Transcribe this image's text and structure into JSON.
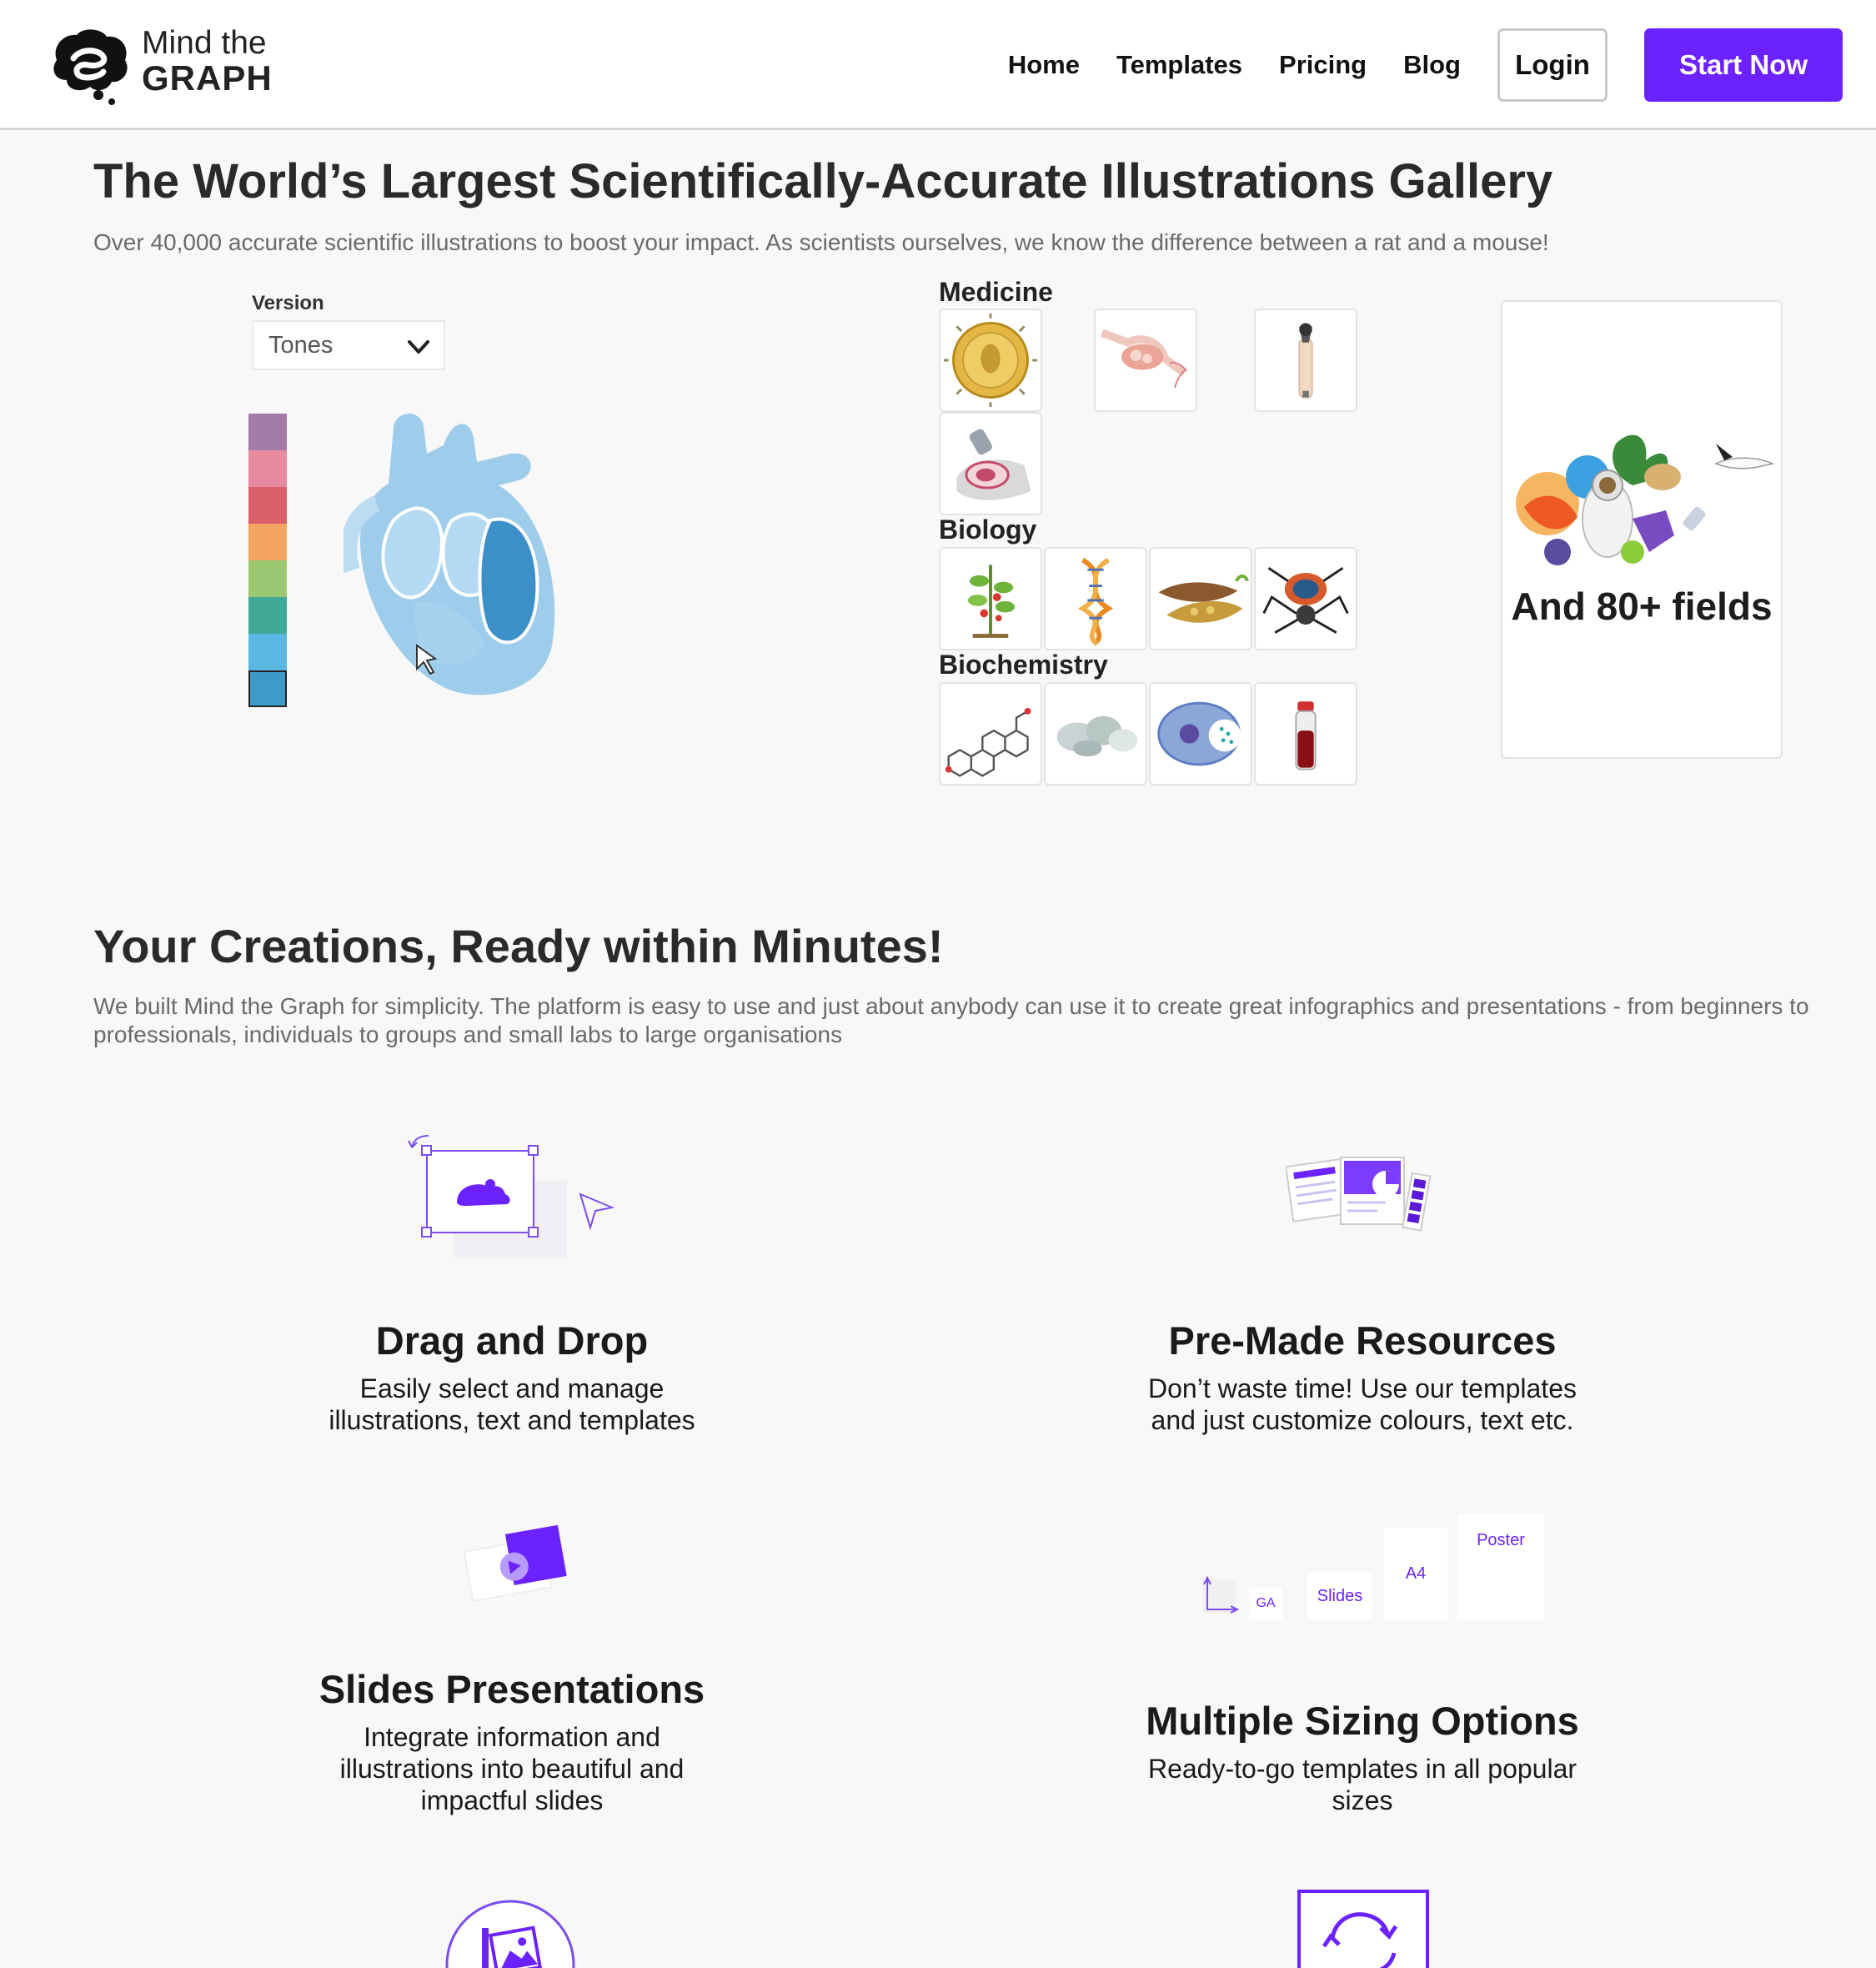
{
  "header": {
    "logo_line1": "Mind the",
    "logo_line2": "GRAPH",
    "nav": [
      "Home",
      "Templates",
      "Pricing",
      "Blog"
    ],
    "login_label": "Login",
    "start_label": "Start Now",
    "accent_color": "#6c21ff"
  },
  "gallery": {
    "title": "The World’s Largest Scientifically-Accurate Illustrations Gallery",
    "subtitle": "Over 40,000 accurate scientific illustrations to boost your impact. As scientists ourselves, we know the difference between a rat and a mouse!",
    "version_label": "Version",
    "version_value": "Tones",
    "tone_swatches": [
      "#a47aa8",
      "#e88aa0",
      "#d95f6a",
      "#f2a661",
      "#9cc772",
      "#3fa996",
      "#5bb8e2",
      "#3c9bc9"
    ],
    "categories": {
      "medicine": "Medicine",
      "biology": "Biology",
      "biochemistry": "Biochemistry"
    },
    "fields_text": "And 80+ fields"
  },
  "creations": {
    "title": "Your Creations, Ready within Minutes!",
    "subtitle": "We built Mind the Graph for simplicity. The platform is easy to use and just about anybody can use it to create great infographics and presentations - from beginners to professionals, individuals to groups and small labs to large organisations",
    "features": [
      {
        "title": "Drag and Drop",
        "desc": "Easily select and manage illustrations, text and templates"
      },
      {
        "title": "Pre-Made Resources",
        "desc": "Don’t waste time! Use our templates and just customize colours, text etc."
      },
      {
        "title": "Slides Presentations",
        "desc": "Integrate information and illustrations into beautiful and impactful slides"
      },
      {
        "title": "Multiple Sizing Options",
        "desc": "Ready-to-go templates in all popular sizes"
      }
    ],
    "sizes": [
      "GA",
      "Slides",
      "A4",
      "Poster"
    ]
  }
}
